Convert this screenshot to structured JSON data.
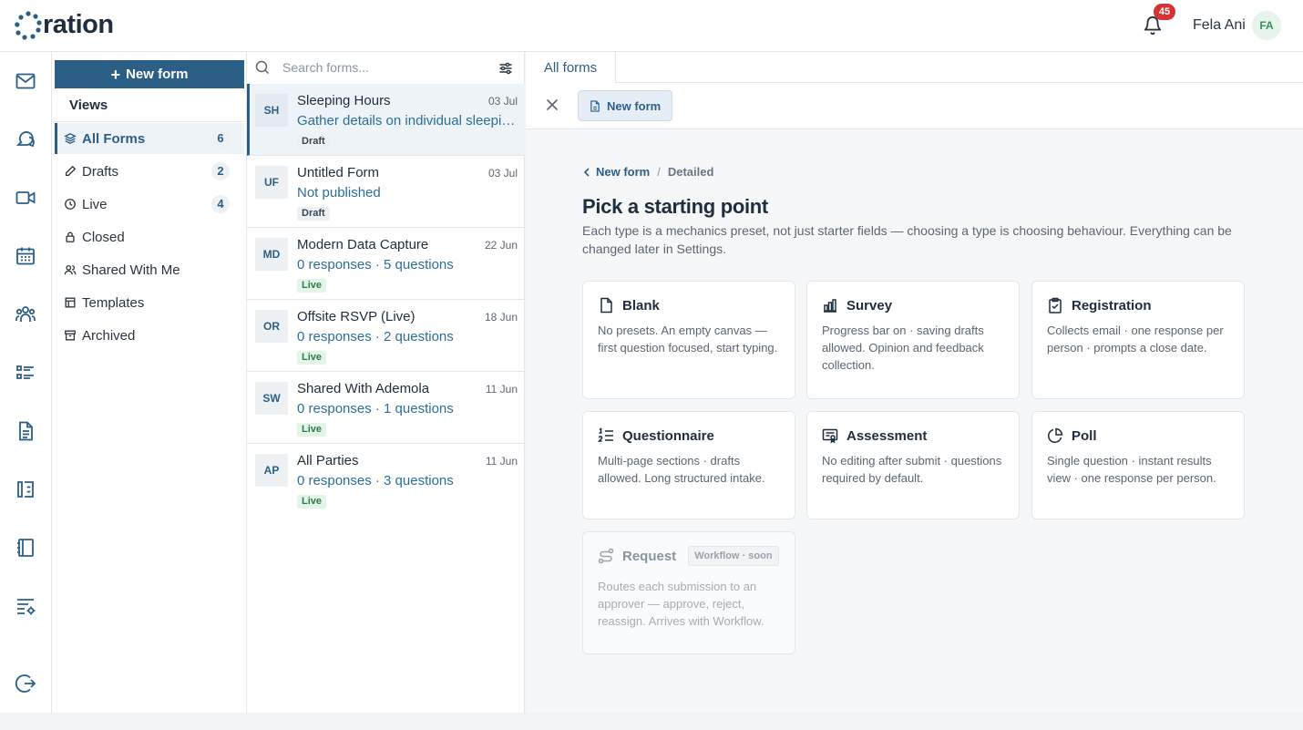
{
  "app": {
    "logo_text": "ration"
  },
  "header": {
    "notification_count": "45",
    "user_name": "Fela Ani",
    "user_initials": "FA"
  },
  "rail": {
    "icons": [
      "mail-icon",
      "chat-icon",
      "video-icon",
      "calendar-icon",
      "people-icon",
      "checklist-icon",
      "document-icon",
      "book-sync-icon",
      "notebook-icon",
      "settings-list-icon",
      "logout-icon"
    ]
  },
  "sidebar": {
    "new_form_label": "New form",
    "views_title": "Views",
    "items": [
      {
        "label": "All Forms",
        "count": "6",
        "icon": "layers-icon"
      },
      {
        "label": "Drafts",
        "count": "2",
        "icon": "pencil-icon"
      },
      {
        "label": "Live",
        "count": "4",
        "icon": "clock-icon"
      },
      {
        "label": "Closed",
        "count": "",
        "icon": "lock-icon"
      },
      {
        "label": "Shared With Me",
        "count": "",
        "icon": "users-icon"
      },
      {
        "label": "Templates",
        "count": "",
        "icon": "templates-icon"
      },
      {
        "label": "Archived",
        "count": "",
        "icon": "archive-icon"
      }
    ]
  },
  "list": {
    "search_placeholder": "Search forms...",
    "items": [
      {
        "initials": "SH",
        "title": "Sleeping Hours",
        "date": "03 Jul",
        "subtitle": "Gather details on individual sleepin...",
        "status": "Draft"
      },
      {
        "initials": "UF",
        "title": "Untitled Form",
        "date": "03 Jul",
        "subtitle": "Not published",
        "status": "Draft"
      },
      {
        "initials": "MD",
        "title": "Modern Data Capture",
        "date": "22 Jun",
        "subtitle": "0 responses · 5 questions",
        "status": "Live"
      },
      {
        "initials": "OR",
        "title": "Offsite RSVP (Live)",
        "date": "18 Jun",
        "subtitle": "0 responses · 2 questions",
        "status": "Live"
      },
      {
        "initials": "SW",
        "title": "Shared With Ademola",
        "date": "11 Jun",
        "subtitle": "0 responses · 1 questions",
        "status": "Live"
      },
      {
        "initials": "AP",
        "title": "All Parties",
        "date": "11 Jun",
        "subtitle": "0 responses · 3 questions",
        "status": "Live"
      }
    ]
  },
  "main": {
    "tab_label": "All forms",
    "chip_label": "New form",
    "breadcrumb": {
      "parent": "New form",
      "separator": "/",
      "current": "Detailed"
    },
    "heading": "Pick a starting point",
    "description": "Each type is a mechanics preset, not just starter fields — choosing a type is choosing behaviour. Everything can be changed later in Settings.",
    "cards": [
      {
        "title": "Blank",
        "icon": "file-icon",
        "desc": "No presets. An empty canvas — first question focused, start typing."
      },
      {
        "title": "Survey",
        "icon": "bar-chart-icon",
        "desc": "Progress bar on · saving drafts allowed. Opinion and feedback collection."
      },
      {
        "title": "Registration",
        "icon": "clipboard-check-icon",
        "desc": "Collects email · one response per person · prompts a close date."
      },
      {
        "title": "Questionnaire",
        "icon": "numbered-list-icon",
        "desc": "Multi-page sections · drafts allowed. Long structured intake."
      },
      {
        "title": "Assessment",
        "icon": "certificate-icon",
        "desc": "No editing after submit · questions required by default."
      },
      {
        "title": "Poll",
        "icon": "pie-chart-icon",
        "desc": "Single question · instant results view · one response per person."
      },
      {
        "title": "Request",
        "icon": "route-icon",
        "badge": "Workflow · soon",
        "desc": "Routes each submission to an approver — approve, reject, reassign. Arrives with Workflow."
      }
    ]
  },
  "colors": {
    "accent": "#2c5f86",
    "link": "#2c6e9a",
    "badge_red": "#d63434",
    "live_green": "#2e7d48"
  }
}
